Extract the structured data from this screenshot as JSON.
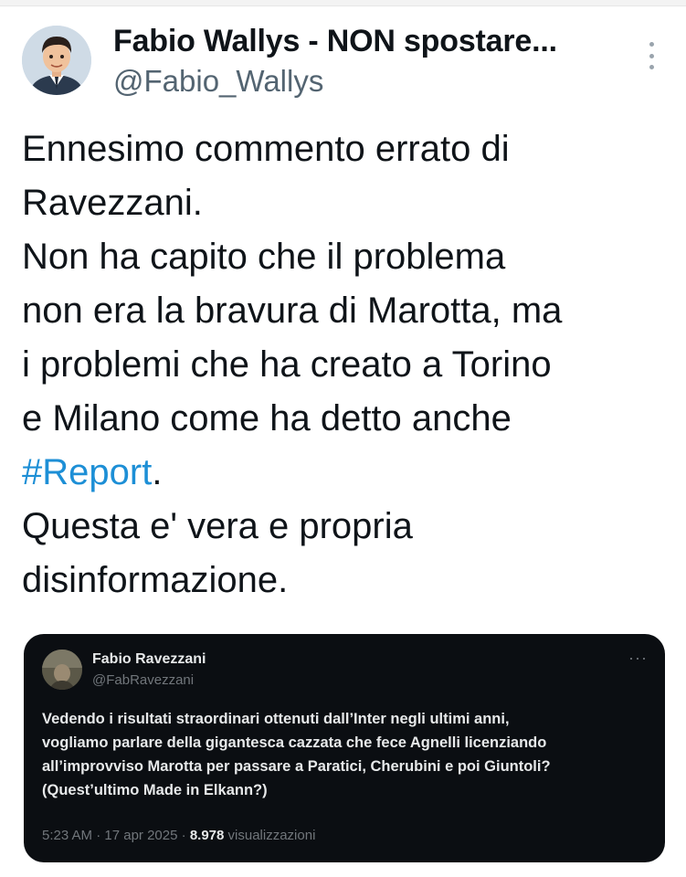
{
  "tweet": {
    "author_name": "Fabio Wallys - NON spostare...",
    "author_handle": "@Fabio_Wallys",
    "text_lines": [
      "Ennesimo commento errato di",
      "Ravezzani.",
      "Non ha capito che il problema",
      "non era la bravura di Marotta, ma",
      "i problemi che ha creato a Torino",
      "e Milano come ha detto anche"
    ],
    "hashtag": "#Report",
    "hashtag_suffix": ".",
    "text_lines_after": [
      "Questa e' vera e propria",
      "disinformazione."
    ]
  },
  "quote": {
    "author_name": "Fabio Ravezzani",
    "author_handle": "@FabRavezzani",
    "more_label": "···",
    "text_lines": [
      "Vedendo i risultati straordinari ottenuti dall’Inter negli ultimi anni,",
      "vogliamo parlare della gigantesca cazzata che fece Agnelli licenziando",
      "all’improvviso Marotta per passare a Paratici, Cherubini e poi Giuntoli?",
      "(Quest’ultimo Made in Elkann?)"
    ],
    "time": "5:23 AM",
    "separator": "·",
    "date": "17 apr 2025",
    "views_count": "8.978",
    "views_label": "visualizzazioni"
  },
  "colors": {
    "hashtag": "#1d8fd6",
    "quote_background": "#0b0e12"
  },
  "icons": {
    "more": "more-vertical-icon",
    "avatar": "cartoon-man-avatar",
    "quote_more": "more-horizontal-icon"
  }
}
